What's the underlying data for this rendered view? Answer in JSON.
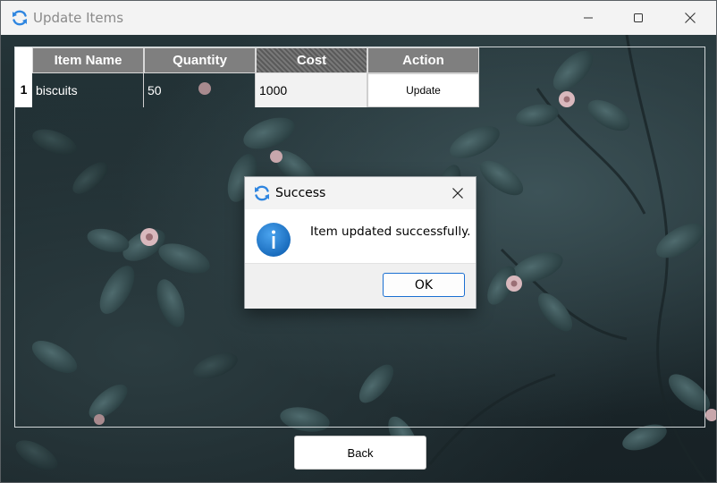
{
  "window": {
    "title": "Update Items",
    "icon": "sync-arrows-icon",
    "controls": [
      "minimize-icon",
      "maximize-icon",
      "close-icon"
    ]
  },
  "table": {
    "columns": [
      "Item Name",
      "Quantity",
      "Cost",
      "Action"
    ],
    "selected_column": "Cost",
    "rows": [
      {
        "number": "1",
        "item_name": "biscuits",
        "quantity": "50",
        "cost": "1000",
        "action": "Update"
      }
    ]
  },
  "back_button": {
    "label": "Back"
  },
  "dialog": {
    "title": "Success",
    "icon": "sync-arrows-icon",
    "message_icon": "info-icon",
    "message": "Item updated successfully.",
    "ok_label": "OK"
  },
  "colors": {
    "title_text": "#8a8a8a",
    "header_bg": "#7f7f7f",
    "info_blue": "#1979ca",
    "ok_border": "#1a6fd1",
    "accent_icon": "#2f86e0"
  }
}
